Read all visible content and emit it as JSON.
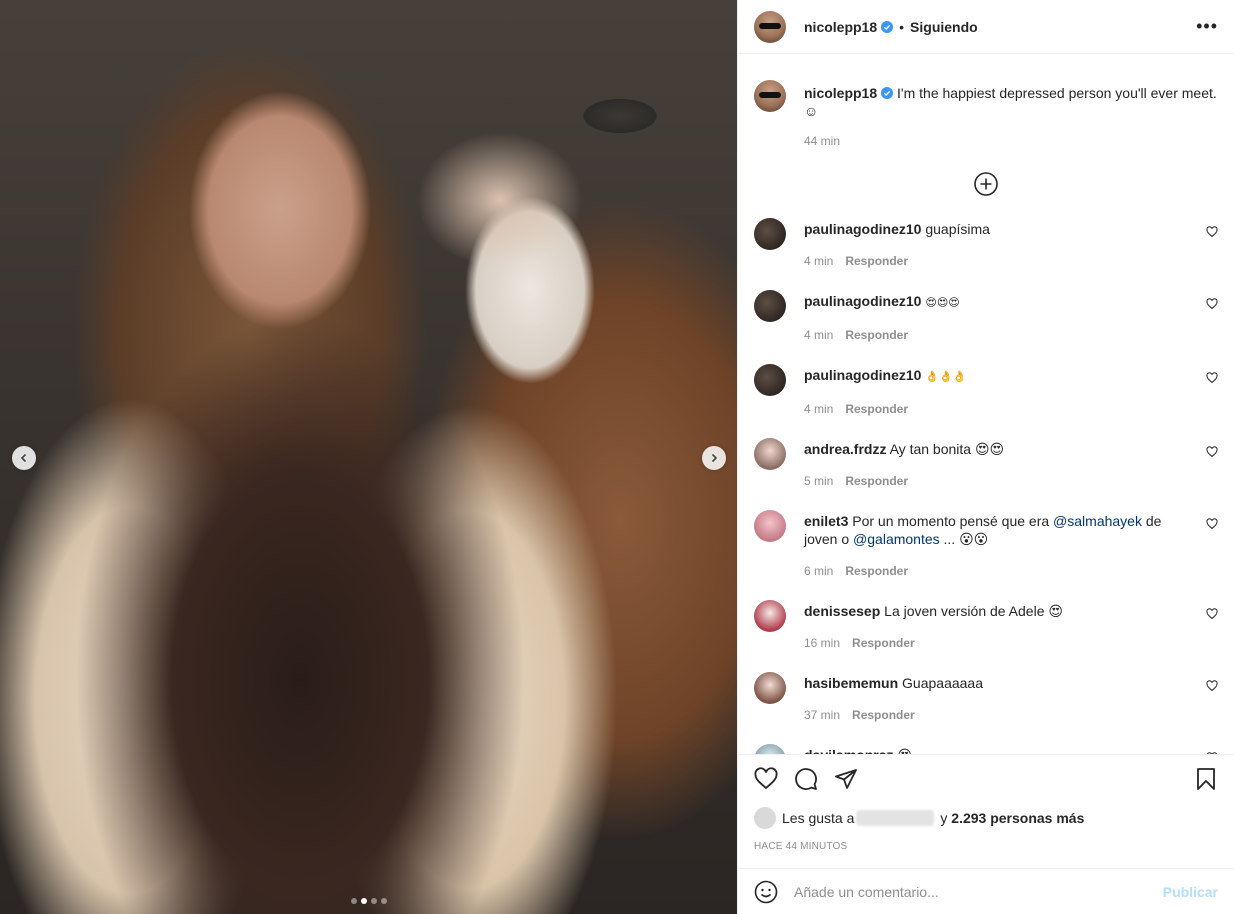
{
  "post": {
    "username": "nicolepp18",
    "follow_status": "Siguiendo",
    "separator": "•",
    "caption": "I'm the happiest depressed person you'll ever meet. ☺",
    "caption_time": "44 min",
    "photo_dots": 4,
    "photo_active_dot": 2
  },
  "icons": {
    "verified": "verified-badge-icon",
    "more": "more-options-icon",
    "load_more": "plus-circle-icon",
    "heart": "heart-icon",
    "comment": "comment-icon",
    "share": "send-icon",
    "save": "bookmark-icon",
    "emoji": "emoji-smile-icon",
    "prev": "chevron-left-icon",
    "next": "chevron-right-icon"
  },
  "colors": {
    "verified": "#3897f0",
    "mention": "#00376b",
    "publish_disabled": "#b2dffc",
    "meta_gray": "#8e8e8e"
  },
  "reply_label": "Responder",
  "comments": [
    {
      "user": "paulinagodinez10",
      "text": "guapísima",
      "time": "4 min"
    },
    {
      "user": "paulinagodinez10",
      "text": "😍😍😍",
      "time": "4 min"
    },
    {
      "user": "paulinagodinez10",
      "text": "👌👌👌",
      "time": "4 min"
    },
    {
      "user": "andrea.frdzz",
      "text": "Ay tan bonita 😍😍",
      "time": "5 min"
    },
    {
      "user": "enilet3",
      "text_before": "Por un momento pensé que era ",
      "mention1": "@salmahayek",
      "text_mid": " de joven o ",
      "mention2": "@galamontes",
      "text_after": " ... 😮😮",
      "time": "6 min"
    },
    {
      "user": "denissesep",
      "text": "La joven versión de Adele 😍",
      "time": "16 min"
    },
    {
      "user": "hasibememun",
      "text": "Guapaaaaaa",
      "time": "37 min"
    },
    {
      "user": "davilamonraz",
      "text": "😍",
      "time": ""
    }
  ],
  "likes": {
    "prefix": "Les gusta a",
    "conjunction": "y",
    "count_text": "2.293 personas más"
  },
  "time_ago": "HACE 44 MINUTOS",
  "add_comment": {
    "placeholder": "Añade un comentario...",
    "publish_label": "Publicar"
  }
}
